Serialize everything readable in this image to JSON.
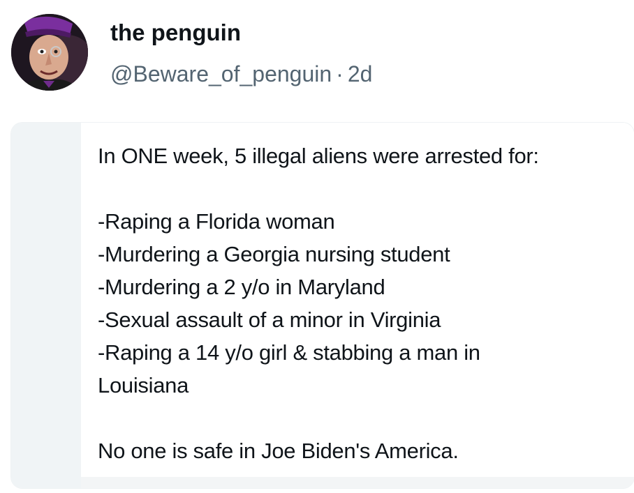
{
  "post": {
    "author": {
      "display_name": "the penguin",
      "handle": "@Beware_of_penguin",
      "separator": "·",
      "time": "2d",
      "avatar_icon": "penguin-villain-avatar"
    },
    "card": {
      "lines": [
        "In ONE week, 5 illegal aliens were arrested for:",
        "",
        "-Raping a Florida woman",
        "-Murdering a Georgia nursing student",
        "-Murdering a 2 y/o in Maryland",
        "-Sexual assault of a minor in Virginia",
        "-Raping a 14 y/o girl & stabbing a man in",
        "Louisiana",
        "",
        "No one is safe in Joe Biden's America."
      ]
    }
  },
  "colors": {
    "text_primary": "#0f1419",
    "text_secondary": "#536471",
    "card_strip": "#f0f4f6"
  }
}
